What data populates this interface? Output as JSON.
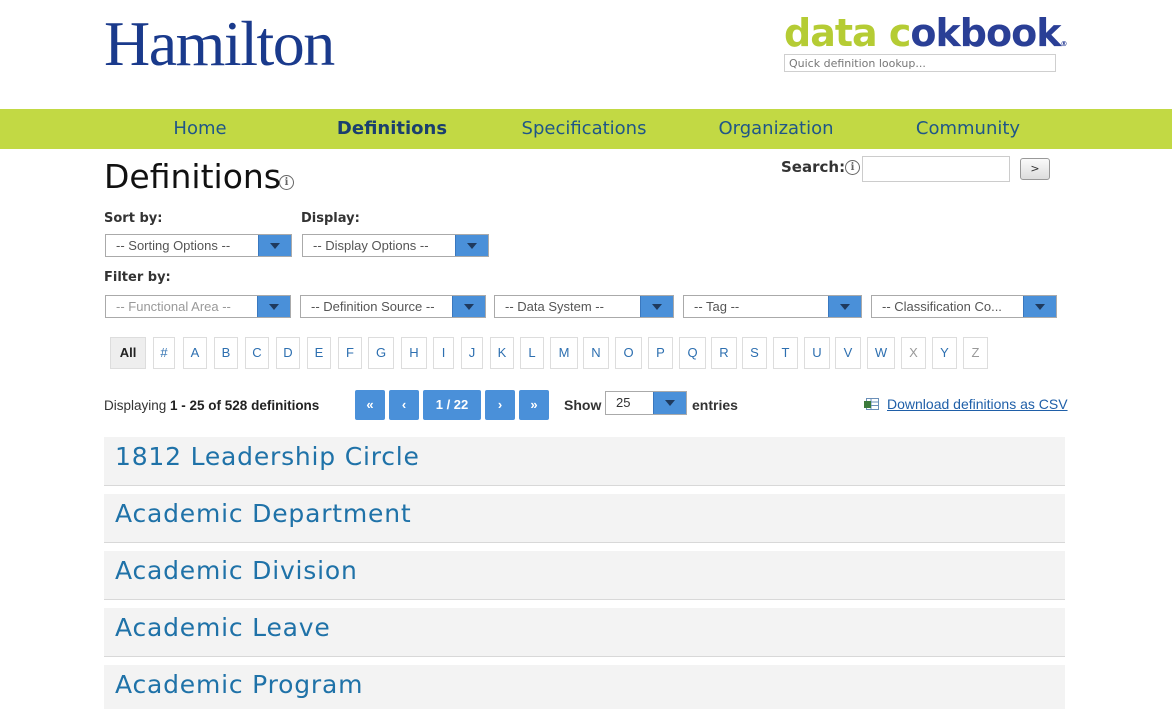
{
  "header": {
    "brand": "Hamilton",
    "product_part1": "data c",
    "product_part2": "okbook",
    "product_mark": "®",
    "quick_lookup_placeholder": "Quick definition lookup..."
  },
  "nav": {
    "items": [
      {
        "label": "Home"
      },
      {
        "label": "Definitions"
      },
      {
        "label": "Specifications"
      },
      {
        "label": "Organization"
      },
      {
        "label": "Community"
      }
    ],
    "active": "Definitions"
  },
  "page": {
    "title": "Definitions",
    "search_label": "Search:",
    "search_button": ">",
    "search_value": ""
  },
  "controls": {
    "sort_label": "Sort by:",
    "sort_value": "-- Sorting Options --",
    "display_label": "Display:",
    "display_value": "-- Display Options --",
    "filter_label": "Filter by:",
    "filters": [
      {
        "value": "-- Functional Area --",
        "disabled": true
      },
      {
        "value": "-- Definition Source --",
        "disabled": false
      },
      {
        "value": "-- Data System --",
        "disabled": false
      },
      {
        "value": "-- Tag --",
        "disabled": false
      },
      {
        "value": "-- Classification Co...",
        "disabled": false
      }
    ]
  },
  "letters": {
    "items": [
      "All",
      "#",
      "A",
      "B",
      "C",
      "D",
      "E",
      "F",
      "G",
      "H",
      "I",
      "J",
      "K",
      "L",
      "M",
      "N",
      "O",
      "P",
      "Q",
      "R",
      "S",
      "T",
      "U",
      "V",
      "W",
      "X",
      "Y",
      "Z"
    ],
    "selected": "All",
    "disabled": [
      "X",
      "Z"
    ]
  },
  "pagination": {
    "display_prefix": "Displaying ",
    "range": "1 - 25 of 528 definitions",
    "first": "«",
    "prev": "‹",
    "page_indicator": "1 / 22",
    "next": "›",
    "last": "»",
    "show_label": "Show",
    "page_size": "25",
    "entries_label": "entries",
    "csv_link": "Download definitions as CSV"
  },
  "definitions": [
    "1812 Leadership Circle",
    "Academic Department",
    "Academic Division",
    "Academic Leave",
    "Academic Program"
  ],
  "colors": {
    "nav_bg": "#c2d944",
    "accent_blue": "#4a90d9",
    "brand_navy": "#1a3a8c",
    "link_blue": "#1f72a8"
  }
}
